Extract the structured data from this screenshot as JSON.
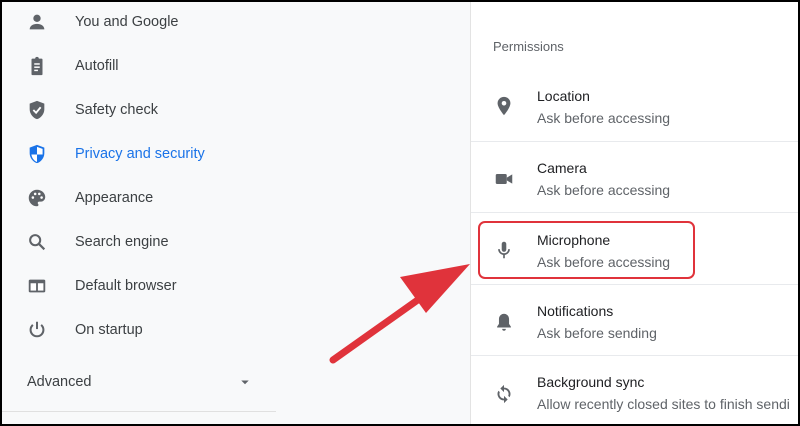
{
  "sidebar": {
    "items": [
      {
        "label": "You and Google",
        "icon": "person-icon"
      },
      {
        "label": "Autofill",
        "icon": "clipboard-icon"
      },
      {
        "label": "Safety check",
        "icon": "shield-check-icon"
      },
      {
        "label": "Privacy and security",
        "icon": "shield-icon",
        "active": true
      },
      {
        "label": "Appearance",
        "icon": "palette-icon"
      },
      {
        "label": "Search engine",
        "icon": "search-icon"
      },
      {
        "label": "Default browser",
        "icon": "browser-window-icon"
      },
      {
        "label": "On startup",
        "icon": "power-icon"
      }
    ],
    "advanced_label": "Advanced"
  },
  "permissions": {
    "section_title": "Permissions",
    "items": [
      {
        "title": "Location",
        "subtitle": "Ask before accessing",
        "icon": "location-pin-icon"
      },
      {
        "title": "Camera",
        "subtitle": "Ask before accessing",
        "icon": "camera-icon"
      },
      {
        "title": "Microphone",
        "subtitle": "Ask before accessing",
        "icon": "microphone-icon"
      },
      {
        "title": "Notifications",
        "subtitle": "Ask before sending",
        "icon": "bell-icon"
      },
      {
        "title": "Background sync",
        "subtitle": "Allow recently closed sites to finish sendi",
        "icon": "sync-icon"
      }
    ]
  },
  "colors": {
    "accent": "#1a73e8",
    "icon_gray": "#5f6368",
    "annotation_red": "#e0333b"
  }
}
